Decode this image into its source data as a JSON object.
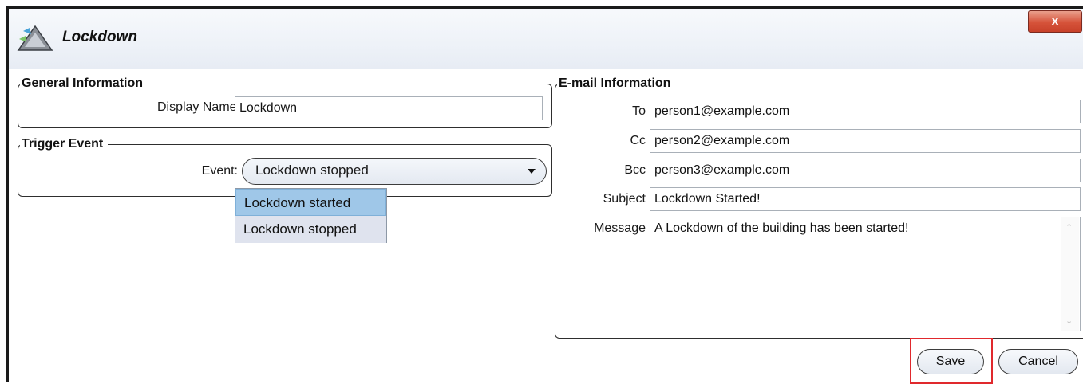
{
  "window": {
    "title": "Lockdown",
    "close_label": "X",
    "icon": "app-triangle-icon"
  },
  "general": {
    "legend": "General Information",
    "display_name_label": "Display Name:",
    "display_name_value": "Lockdown"
  },
  "trigger": {
    "legend": "Trigger Event",
    "event_label": "Event:",
    "event_value": "Lockdown stopped",
    "options": [
      "Lockdown started",
      "Lockdown stopped"
    ],
    "highlighted_option": "Lockdown started"
  },
  "email": {
    "legend": "E-mail Information",
    "to_label": "To",
    "to_value": "person1@example.com",
    "cc_label": "Cc",
    "cc_value": "person2@example.com",
    "bcc_label": "Bcc",
    "bcc_value": "person3@example.com",
    "subject_label": "Subject",
    "subject_value": "Lockdown Started!",
    "message_label": "Message",
    "message_value": "A Lockdown of the building has been started!"
  },
  "buttons": {
    "save": "Save",
    "cancel": "Cancel"
  },
  "colors": {
    "highlight_border": "#e0292d",
    "close_button": "#d6533a",
    "dropdown_highlight": "#9fc7e8"
  }
}
